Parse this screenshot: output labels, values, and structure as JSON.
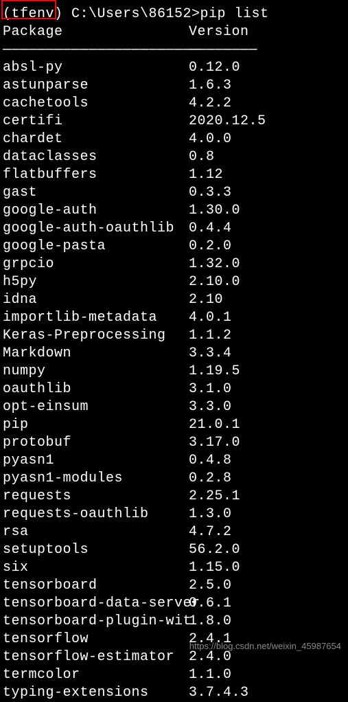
{
  "prompt": {
    "env": "(tfenv)",
    "path": " C:\\Users\\86152>",
    "command": "pip list"
  },
  "header": {
    "package": "Package",
    "version": "Version"
  },
  "separator": {
    "package": "———————————————————————",
    "version": "————————"
  },
  "packages": [
    {
      "name": "absl-py",
      "version": "0.12.0"
    },
    {
      "name": "astunparse",
      "version": "1.6.3"
    },
    {
      "name": "cachetools",
      "version": "4.2.2"
    },
    {
      "name": "certifi",
      "version": "2020.12.5"
    },
    {
      "name": "chardet",
      "version": "4.0.0"
    },
    {
      "name": "dataclasses",
      "version": "0.8"
    },
    {
      "name": "flatbuffers",
      "version": "1.12"
    },
    {
      "name": "gast",
      "version": "0.3.3"
    },
    {
      "name": "google-auth",
      "version": "1.30.0"
    },
    {
      "name": "google-auth-oauthlib",
      "version": "0.4.4"
    },
    {
      "name": "google-pasta",
      "version": "0.2.0"
    },
    {
      "name": "grpcio",
      "version": "1.32.0"
    },
    {
      "name": "h5py",
      "version": "2.10.0"
    },
    {
      "name": "idna",
      "version": "2.10"
    },
    {
      "name": "importlib-metadata",
      "version": "4.0.1"
    },
    {
      "name": "Keras-Preprocessing",
      "version": "1.1.2"
    },
    {
      "name": "Markdown",
      "version": "3.3.4"
    },
    {
      "name": "numpy",
      "version": "1.19.5"
    },
    {
      "name": "oauthlib",
      "version": "3.1.0"
    },
    {
      "name": "opt-einsum",
      "version": "3.3.0"
    },
    {
      "name": "pip",
      "version": "21.0.1"
    },
    {
      "name": "protobuf",
      "version": "3.17.0"
    },
    {
      "name": "pyasn1",
      "version": "0.4.8"
    },
    {
      "name": "pyasn1-modules",
      "version": "0.2.8"
    },
    {
      "name": "requests",
      "version": "2.25.1"
    },
    {
      "name": "requests-oauthlib",
      "version": "1.3.0"
    },
    {
      "name": "rsa",
      "version": "4.7.2"
    },
    {
      "name": "setuptools",
      "version": "56.2.0"
    },
    {
      "name": "six",
      "version": "1.15.0"
    },
    {
      "name": "tensorboard",
      "version": "2.5.0"
    },
    {
      "name": "tensorboard-data-server",
      "version": "0.6.1"
    },
    {
      "name": "tensorboard-plugin-wit",
      "version": "1.8.0"
    },
    {
      "name": "tensorflow",
      "version": "2.4.1"
    },
    {
      "name": "tensorflow-estimator",
      "version": "2.4.0"
    },
    {
      "name": "termcolor",
      "version": "1.1.0"
    },
    {
      "name": "typing-extensions",
      "version": "3.7.4.3"
    }
  ],
  "watermark": "https://blog.csdn.net/weixin_45987654"
}
